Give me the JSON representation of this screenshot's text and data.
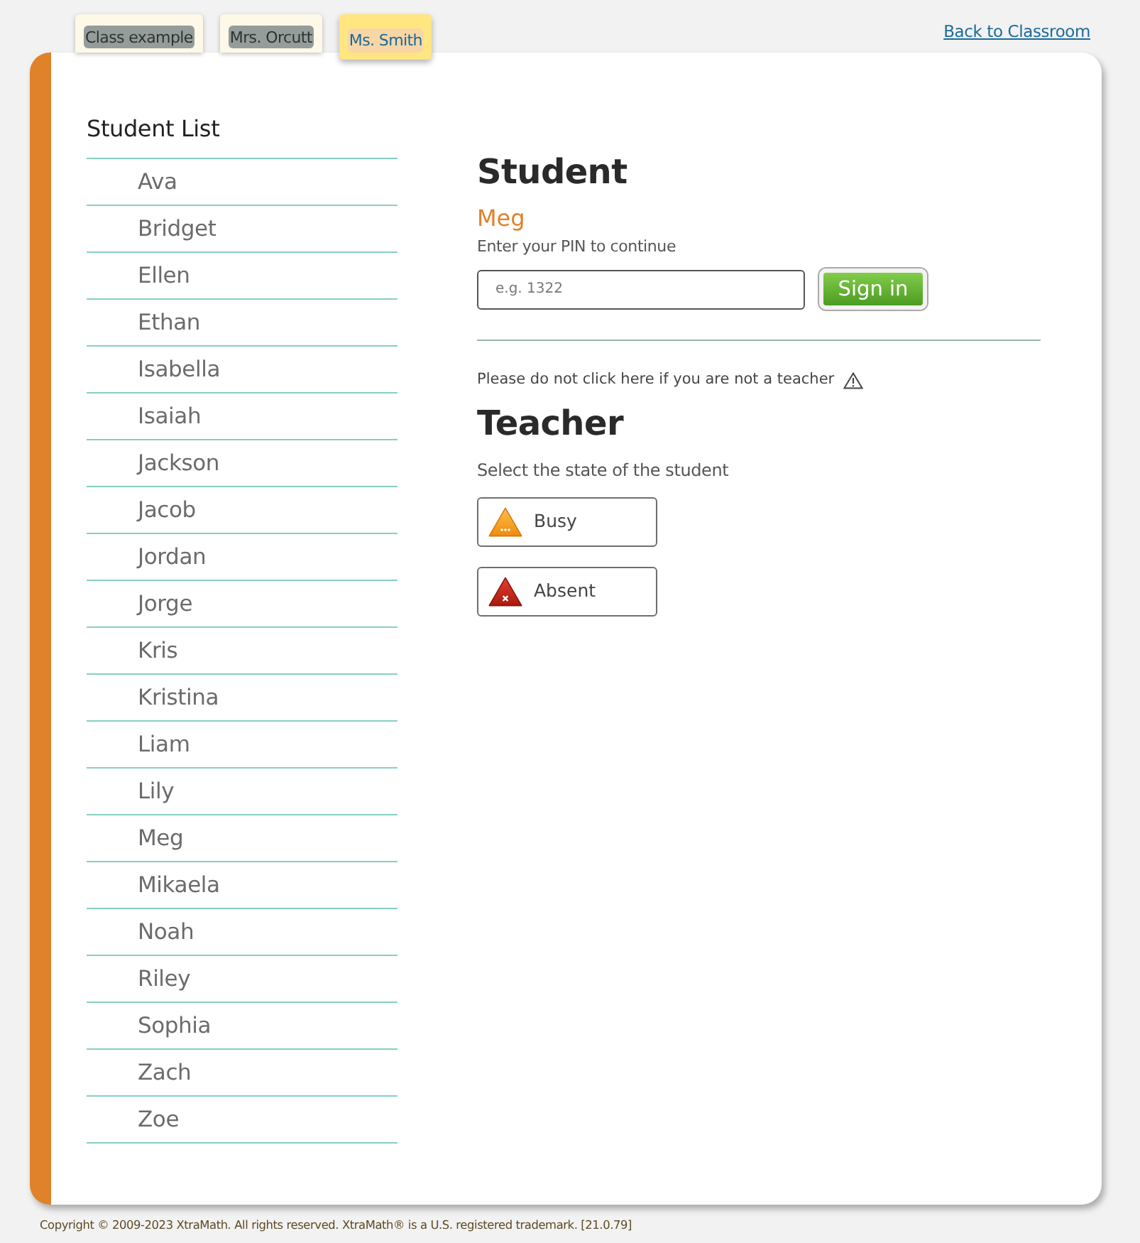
{
  "header": {
    "class_tabs": [
      {
        "label": "Class example",
        "selected": false
      },
      {
        "label": "Mrs. Orcutt",
        "selected": false
      },
      {
        "label": "Ms. Smith",
        "selected": true
      }
    ],
    "back_link": "Back to Classroom"
  },
  "student_list": {
    "title": "Student List",
    "students": [
      "Ava",
      "Bridget",
      "Ellen",
      "Ethan",
      "Isabella",
      "Isaiah",
      "Jackson",
      "Jacob",
      "Jordan",
      "Jorge",
      "Kris",
      "Kristina",
      "Liam",
      "Lily",
      "Meg",
      "Mikaela",
      "Noah",
      "Riley",
      "Sophia",
      "Zach",
      "Zoe"
    ]
  },
  "student_panel": {
    "title": "Student",
    "student_name": "Meg",
    "prompt": "Enter your PIN to continue",
    "pin_field": {
      "placeholder": "e.g. 1322"
    },
    "sign_in_button": "Sign in"
  },
  "teacher_panel": {
    "warning": "Please do not click here if you are not a teacher",
    "title": "Teacher",
    "prompt": "Select the state of the student",
    "state_buttons": [
      {
        "label": "Busy",
        "kind": "busy"
      },
      {
        "label": "Absent",
        "kind": "absent"
      }
    ]
  },
  "footer": {
    "copyright": "Copyright © 2009-2023 XtraMath. All rights reserved. XtraMath® is a U.S. registered trademark. [21.0.79]"
  }
}
